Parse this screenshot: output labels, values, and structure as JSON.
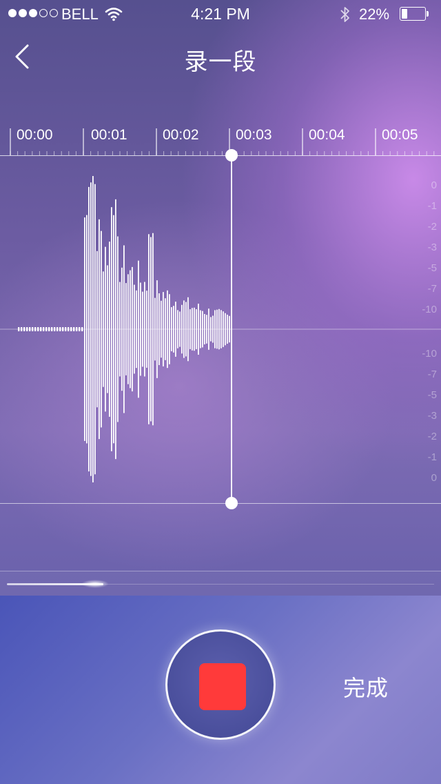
{
  "status_bar": {
    "carrier": "BELL",
    "time": "4:21 PM",
    "battery_percent": "22%",
    "battery_level": 0.22,
    "signal_bars_filled": 3,
    "signal_bars_total": 5,
    "icons": [
      "signal-dots-icon",
      "wifi-icon",
      "bluetooth-icon",
      "battery-icon"
    ]
  },
  "nav": {
    "back_icon": "chevron-left-icon",
    "title": "录一段"
  },
  "timeline": {
    "labels": [
      "00:00",
      "00:01",
      "00:02",
      "00:03",
      "00:04",
      "00:05"
    ]
  },
  "waveform": {
    "db_scale_top": [
      "0",
      "-1",
      "-2",
      "-3",
      "-5",
      "-7",
      "-10"
    ],
    "db_scale_bottom": [
      "-10",
      "-7",
      "-5",
      "-3",
      "-2",
      "-1",
      "0"
    ],
    "playhead_time_seconds": 3.0
  },
  "overview": {
    "progress_fraction": 0.22
  },
  "controls": {
    "record_button_icon": "stop-icon",
    "done_label": "完成"
  },
  "colors": {
    "stop_red": "#ff3a3a",
    "waveform_white": "#ffffff"
  }
}
